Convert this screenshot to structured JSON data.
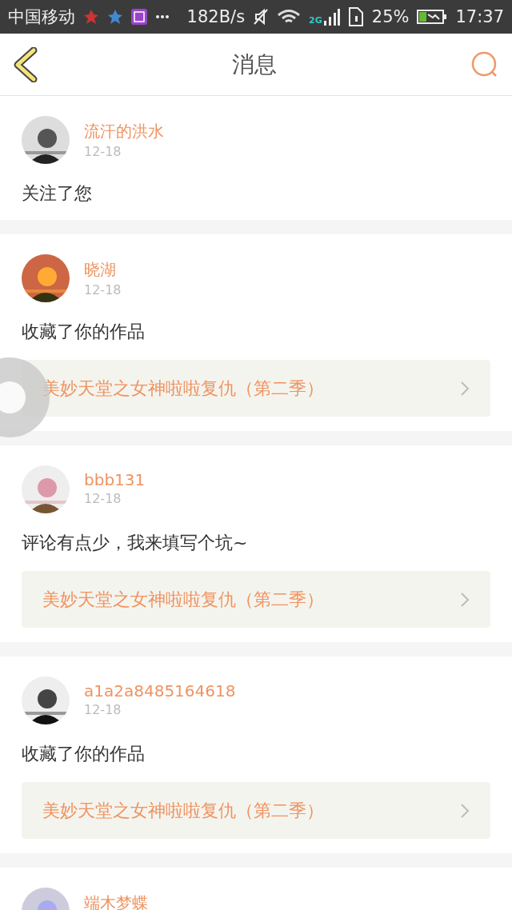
{
  "status_bar": {
    "carrier": "中国移动",
    "speed": "182B/s",
    "network": "2G",
    "battery": "25%",
    "time": "17:37"
  },
  "header": {
    "title": "消息"
  },
  "messages": [
    {
      "user": "流汗的洪水",
      "date": "12-18",
      "text": "关注了您"
    },
    {
      "user": "晓湖",
      "date": "12-18",
      "text": "收藏了你的作品",
      "work": "美妙天堂之女神啦啦复仇（第二季）"
    },
    {
      "user": "bbb131",
      "date": "12-18",
      "text": "评论有点少，我来填写个坑~",
      "work": "美妙天堂之女神啦啦复仇（第二季）"
    },
    {
      "user": "a1a2a8485164618",
      "date": "12-18",
      "text": "收藏了你的作品",
      "work": "美妙天堂之女神啦啦复仇（第二季）"
    },
    {
      "user": "端木梦蝶"
    }
  ]
}
